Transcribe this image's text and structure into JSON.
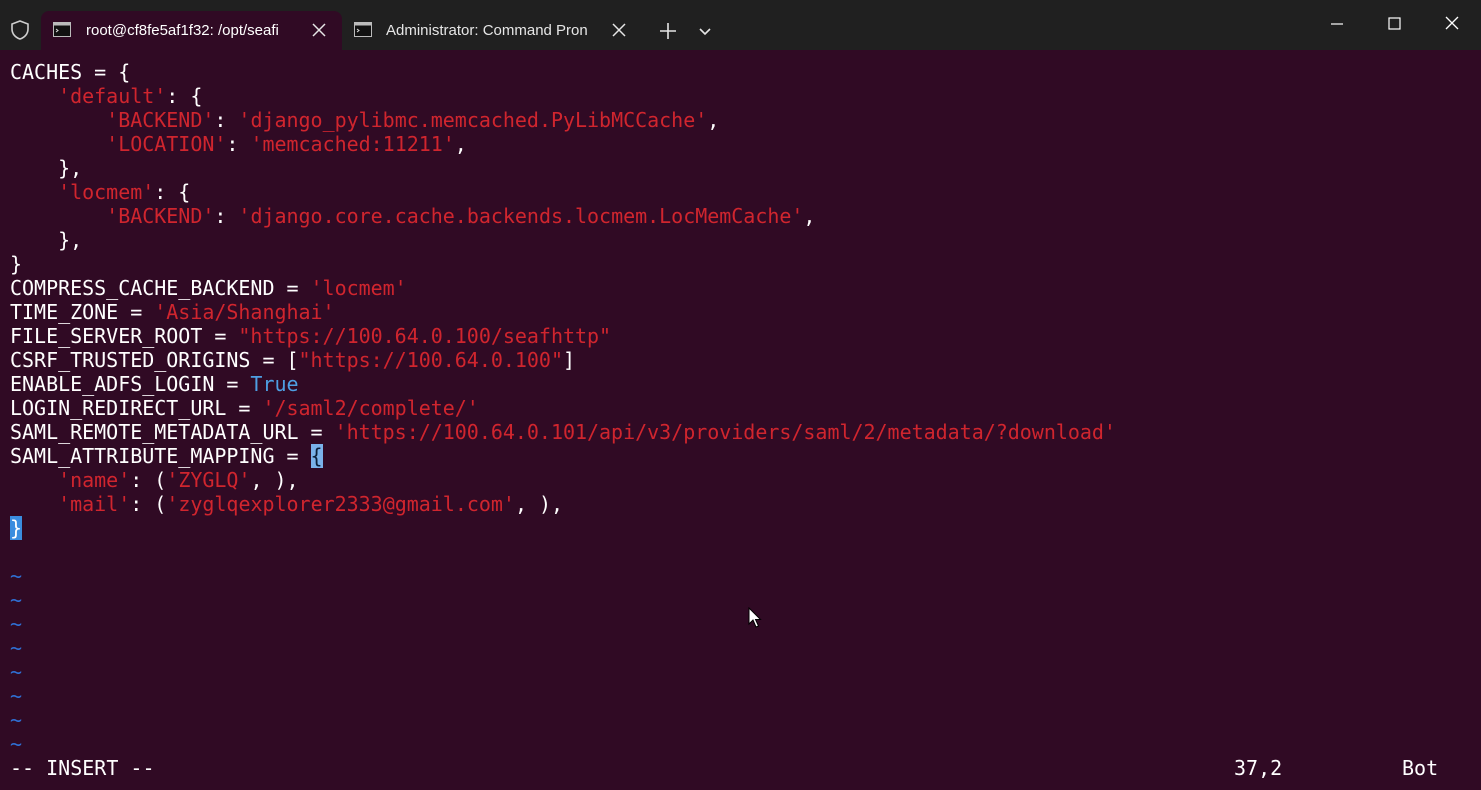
{
  "titlebar": {
    "tabs": [
      {
        "label": "root@cf8fe5af1f32: /opt/seafi",
        "active": true
      },
      {
        "label": "Administrator: Command Pron",
        "active": false
      }
    ]
  },
  "terminal": {
    "lines": [
      [
        {
          "t": "CACHES = {",
          "c": ""
        }
      ],
      [
        {
          "t": "    ",
          "c": ""
        },
        {
          "t": "'default'",
          "c": "str"
        },
        {
          "t": ": {",
          "c": ""
        }
      ],
      [
        {
          "t": "        ",
          "c": ""
        },
        {
          "t": "'BACKEND'",
          "c": "str"
        },
        {
          "t": ": ",
          "c": ""
        },
        {
          "t": "'django_pylibmc.memcached.PyLibMCCache'",
          "c": "str"
        },
        {
          "t": ",",
          "c": ""
        }
      ],
      [
        {
          "t": "        ",
          "c": ""
        },
        {
          "t": "'LOCATION'",
          "c": "str"
        },
        {
          "t": ": ",
          "c": ""
        },
        {
          "t": "'memcached:11211'",
          "c": "str"
        },
        {
          "t": ",",
          "c": ""
        }
      ],
      [
        {
          "t": "    },",
          "c": ""
        }
      ],
      [
        {
          "t": "    ",
          "c": ""
        },
        {
          "t": "'locmem'",
          "c": "str"
        },
        {
          "t": ": {",
          "c": ""
        }
      ],
      [
        {
          "t": "        ",
          "c": ""
        },
        {
          "t": "'BACKEND'",
          "c": "str"
        },
        {
          "t": ": ",
          "c": ""
        },
        {
          "t": "'django.core.cache.backends.locmem.LocMemCache'",
          "c": "str"
        },
        {
          "t": ",",
          "c": ""
        }
      ],
      [
        {
          "t": "    },",
          "c": ""
        }
      ],
      [
        {
          "t": "}",
          "c": ""
        }
      ],
      [
        {
          "t": "COMPRESS_CACHE_BACKEND = ",
          "c": ""
        },
        {
          "t": "'locmem'",
          "c": "str"
        }
      ],
      [
        {
          "t": "TIME_ZONE = ",
          "c": ""
        },
        {
          "t": "'Asia/Shanghai'",
          "c": "str"
        }
      ],
      [
        {
          "t": "FILE_SERVER_ROOT = ",
          "c": ""
        },
        {
          "t": "\"https://100.64.0.100/seafhttp\"",
          "c": "str"
        }
      ],
      [
        {
          "t": "CSRF_TRUSTED_ORIGINS = [",
          "c": ""
        },
        {
          "t": "\"https://100.64.0.100\"",
          "c": "str"
        },
        {
          "t": "]",
          "c": ""
        }
      ],
      [
        {
          "t": "ENABLE_ADFS_LOGIN = ",
          "c": ""
        },
        {
          "t": "True",
          "c": "kw"
        }
      ],
      [
        {
          "t": "LOGIN_REDIRECT_URL = ",
          "c": ""
        },
        {
          "t": "'/saml2/complete/'",
          "c": "str"
        }
      ],
      [
        {
          "t": "SAML_REMOTE_METADATA_URL = ",
          "c": ""
        },
        {
          "t": "'https://100.64.0.101/api/v3/providers/saml/2/metadata/?download'",
          "c": "str"
        }
      ],
      [
        {
          "t": "SAML_ATTRIBUTE_MAPPING = ",
          "c": ""
        },
        {
          "t": "{",
          "c": "cursor-brace"
        }
      ],
      [
        {
          "t": "    ",
          "c": ""
        },
        {
          "t": "'name'",
          "c": "str"
        },
        {
          "t": ": (",
          "c": ""
        },
        {
          "t": "'ZYGLQ'",
          "c": "str"
        },
        {
          "t": ", ),",
          "c": ""
        }
      ],
      [
        {
          "t": "    ",
          "c": ""
        },
        {
          "t": "'mail'",
          "c": "str"
        },
        {
          "t": ": (",
          "c": ""
        },
        {
          "t": "'zyglqexplorer2333@gmail.com'",
          "c": "str"
        },
        {
          "t": ", ),",
          "c": ""
        }
      ],
      [
        {
          "t": "}",
          "c": "cursor-block"
        }
      ],
      [
        {
          "t": "",
          "c": ""
        }
      ],
      [
        {
          "t": "~",
          "c": "tilde"
        }
      ],
      [
        {
          "t": "~",
          "c": "tilde"
        }
      ],
      [
        {
          "t": "~",
          "c": "tilde"
        }
      ],
      [
        {
          "t": "~",
          "c": "tilde"
        }
      ],
      [
        {
          "t": "~",
          "c": "tilde"
        }
      ],
      [
        {
          "t": "~",
          "c": "tilde"
        }
      ],
      [
        {
          "t": "~",
          "c": "tilde"
        }
      ],
      [
        {
          "t": "~",
          "c": "tilde"
        }
      ]
    ]
  },
  "statusbar": {
    "mode": "-- INSERT --",
    "position": "37,2",
    "scroll": "Bot"
  },
  "colors": {
    "background": "#300a24",
    "string": "#d0252e",
    "keyword": "#4e9fe3",
    "tilde": "#2f6fd3",
    "titlebar": "#202020"
  },
  "icons": [
    "shield-icon",
    "terminal-tab-icon",
    "close-icon",
    "plus-icon",
    "chevron-down-icon",
    "minimize-icon",
    "maximize-icon",
    "window-close-icon",
    "mouse-pointer-icon"
  ]
}
